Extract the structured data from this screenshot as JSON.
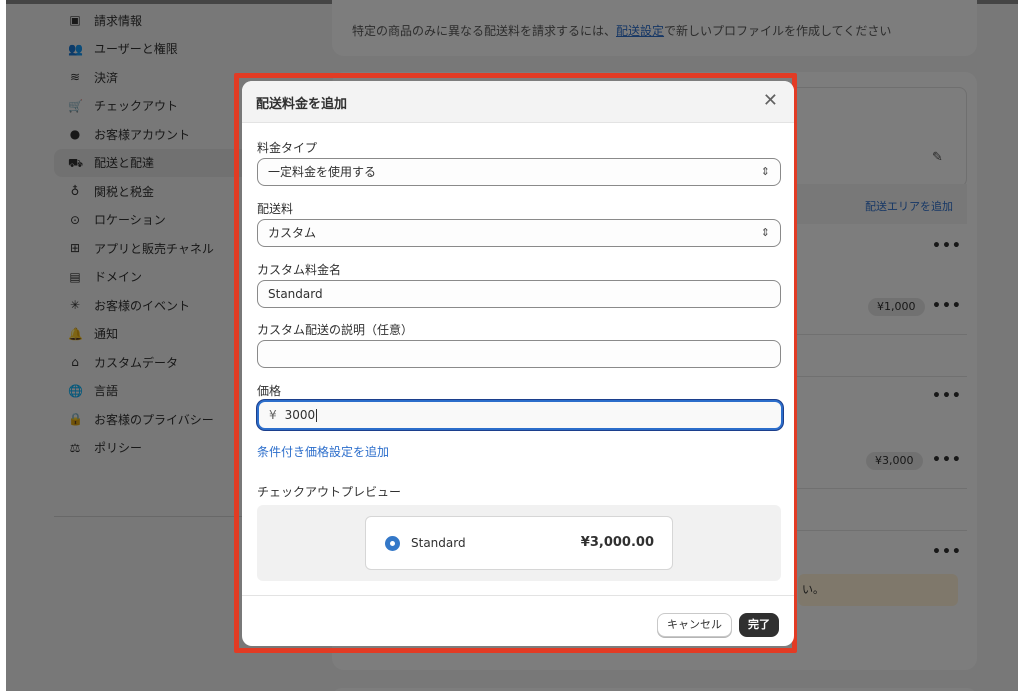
{
  "sidebar": {
    "items": [
      {
        "label": "請求情報",
        "icon": "billing-icon",
        "glyph": "▣"
      },
      {
        "label": "ユーザーと権限",
        "icon": "users-icon",
        "glyph": "👥"
      },
      {
        "label": "決済",
        "icon": "payments-icon",
        "glyph": "≋"
      },
      {
        "label": "チェックアウト",
        "icon": "cart-icon",
        "glyph": "🛒"
      },
      {
        "label": "お客様アカウント",
        "icon": "person-icon",
        "glyph": "●"
      },
      {
        "label": "配送と配達",
        "icon": "truck-icon",
        "glyph": "⛟",
        "active": true
      },
      {
        "label": "関税と税金",
        "icon": "tax-icon",
        "glyph": "♁"
      },
      {
        "label": "ロケーション",
        "icon": "location-icon",
        "glyph": "⊙"
      },
      {
        "label": "アプリと販売チャネル",
        "icon": "apps-icon",
        "glyph": "⊞"
      },
      {
        "label": "ドメイン",
        "icon": "domain-icon",
        "glyph": "▤"
      },
      {
        "label": "お客様のイベント",
        "icon": "events-icon",
        "glyph": "✳"
      },
      {
        "label": "通知",
        "icon": "bell-icon",
        "glyph": "🔔"
      },
      {
        "label": "カスタムデータ",
        "icon": "custom-data-icon",
        "glyph": "⌂"
      },
      {
        "label": "言語",
        "icon": "language-icon",
        "glyph": "🌐"
      },
      {
        "label": "お客様のプライバシー",
        "icon": "lock-icon",
        "glyph": "🔒"
      },
      {
        "label": "ポリシー",
        "icon": "policy-icon",
        "glyph": "⚖"
      }
    ]
  },
  "background": {
    "notice_prefix": "特定の商品のみに異なる配送料を請求するには、",
    "notice_link": "配送設定",
    "notice_suffix": "で新しいプロファイルを作成してください",
    "add_zone_link": "配送エリアを追加",
    "price_badge_1": "¥1,000",
    "price_badge_2": "¥3,000",
    "warning_tail": "い。",
    "more_glyph": "•••"
  },
  "modal": {
    "title": "配送料金を追加",
    "close_glyph": "✕",
    "rate_type_label": "料金タイプ",
    "rate_type_value": "一定料金を使用する",
    "shipping_rate_label": "配送料",
    "shipping_rate_value": "カスタム",
    "custom_name_label": "カスタム料金名",
    "custom_name_value": "Standard",
    "description_label": "カスタム配送の説明（任意）",
    "description_value": "",
    "price_label": "価格",
    "price_prefix": "¥",
    "price_value": "3000",
    "conditional_link": "条件付き価格設定を追加",
    "preview_label": "チェックアウトプレビュー",
    "preview_name": "Standard",
    "preview_price": "¥3,000.00",
    "select_arrow_glyph": "⌃⌄",
    "cancel_label": "キャンセル",
    "done_label": "完了"
  },
  "colors": {
    "highlight_border": "#e23b24",
    "link": "#2c6ecb",
    "primary_button": "#303030",
    "radio": "#3478c8"
  }
}
